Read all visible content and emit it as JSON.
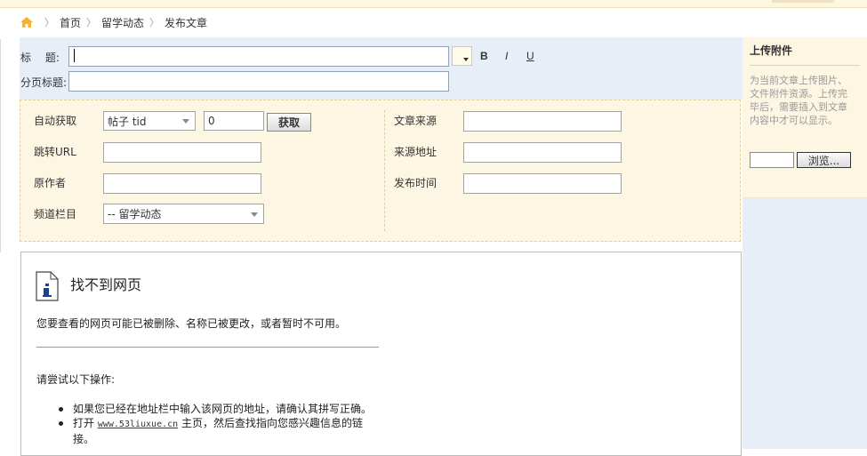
{
  "breadcrumb": {
    "items": [
      "首页",
      "留学动态",
      "发布文章"
    ]
  },
  "form": {
    "title_label": "标　 题:",
    "title_value": "",
    "subtitle_label": "分页标题:",
    "subtitle_value": "",
    "format": {
      "bold": "B",
      "italic": "I",
      "underline": "U"
    }
  },
  "fetch": {
    "auto_fetch_label": "自动获取",
    "source_type_select": "帖子 tid",
    "tid_value": "0",
    "fetch_button": "获取",
    "redirect_url_label": "跳转URL",
    "redirect_url_value": "",
    "author_label": "原作者",
    "author_value": "",
    "channel_label": "频道栏目",
    "channel_select": "-- 留学动态",
    "source_label": "文章来源",
    "source_value": "",
    "source_url_label": "来源地址",
    "source_url_value": "",
    "publish_time_label": "发布时间",
    "publish_time_value": ""
  },
  "attachment": {
    "title": "上传附件",
    "description": "为当前文章上传图片、文件附件资源。上传完毕后，需要插入到文章内容中才可以显示。",
    "file_value": "",
    "browse_button": "浏览..."
  },
  "error_page": {
    "title": "找不到网页",
    "description": "您要查看的网页可能已被删除、名称已被更改，或者暂时不可用。",
    "try_heading": "请尝试以下操作:",
    "items": [
      {
        "text": "如果您已经在地址栏中输入该网页的地址，请确认其拼写正确。"
      },
      {
        "prefix": "打开",
        "link": "www.53liuxue.cn",
        "suffix": "主页，然后查找指向您感兴趣信息的链接。"
      }
    ]
  },
  "colors": {
    "panel_blue": "#e7eef8",
    "panel_cream": "#fcf6e3",
    "home_icon": "#f4b23a"
  }
}
